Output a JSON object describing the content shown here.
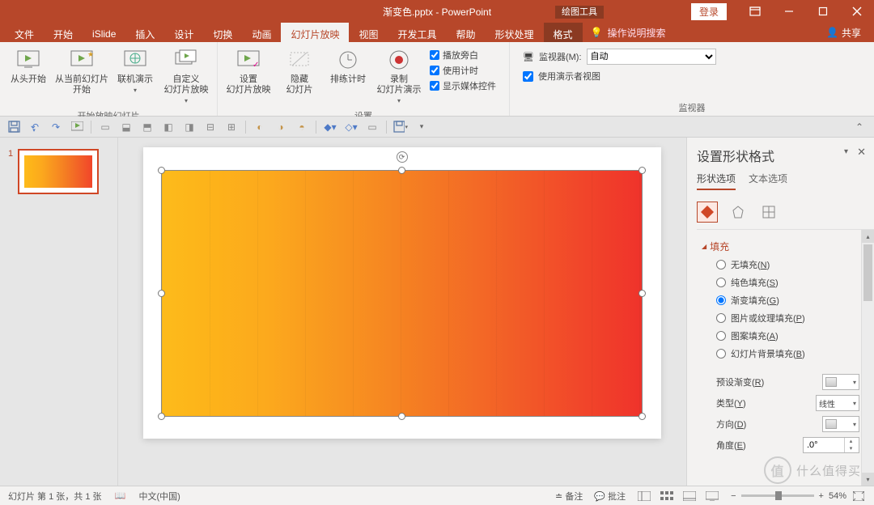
{
  "title": {
    "filename": "渐变色.pptx",
    "app": "PowerPoint",
    "context_group": "绘图工具"
  },
  "win_buttons": {
    "login": "登录"
  },
  "tabs": {
    "file": "文件",
    "home": "开始",
    "islide": "iSlide",
    "insert": "插入",
    "design": "设计",
    "transitions": "切换",
    "animations": "动画",
    "slideshow": "幻灯片放映",
    "view": "视图",
    "developer": "开发工具",
    "help": "帮助",
    "shape": "形状处理",
    "format": "格式",
    "tellme": "操作说明搜索",
    "share": "共享"
  },
  "ribbon": {
    "group1": {
      "label": "开始放映幻灯片",
      "from_begin": "从头开始",
      "from_current": "从当前幻灯片\n开始",
      "online": "联机演示",
      "custom": "自定义\n幻灯片放映"
    },
    "group2": {
      "label": "设置",
      "setup": "设置\n幻灯片放映",
      "hide": "隐藏\n幻灯片",
      "rehearse": "排练计时",
      "record": "录制\n幻灯片演示",
      "chk_narration": "播放旁白",
      "chk_timings": "使用计时",
      "chk_media": "显示媒体控件"
    },
    "group3": {
      "label": "监视器",
      "monitor_label": "监视器(M):",
      "monitor_value": "自动",
      "presenter": "使用演示者视图"
    }
  },
  "thumbs": {
    "n1": "1"
  },
  "pane": {
    "title": "设置形状格式",
    "tab_shape": "形状选项",
    "tab_text": "文本选项",
    "section_fill": "填充",
    "r_none": "无填充(",
    "r_none_k": "N",
    "r_solid": "纯色填充(",
    "r_solid_k": "S",
    "r_grad": "渐变填充(",
    "r_grad_k": "G",
    "r_pic": "图片或纹理填充(",
    "r_pic_k": "P",
    "r_pattern": "图案填充(",
    "r_pattern_k": "A",
    "r_slide": "幻灯片背景填充(",
    "r_slide_k": "B",
    "paren": ")",
    "preset": "预设渐变(",
    "preset_k": "R",
    "type": "类型(",
    "type_k": "Y",
    "type_val": "线性",
    "direction": "方向(",
    "direction_k": "D",
    "angle": "角度(",
    "angle_k": "E",
    "angle_val": ".0°"
  },
  "status": {
    "slide": "幻灯片 第 1 张，共 1 张",
    "lang": "中文(中国)",
    "notes": "备注",
    "comments": "批注",
    "zoom": "54%"
  },
  "watermark": {
    "badge": "值",
    "text": "什么值得买"
  }
}
